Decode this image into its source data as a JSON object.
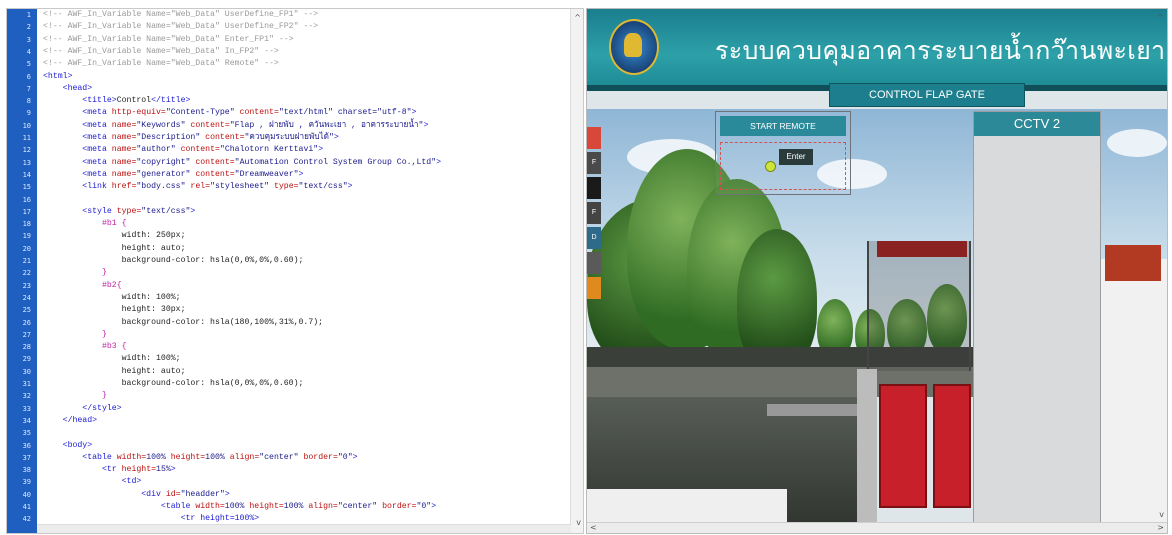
{
  "editor": {
    "line_numbers": [
      "1",
      "2",
      "3",
      "4",
      "5",
      "6",
      "7",
      "8",
      "9",
      "10",
      "11",
      "12",
      "13",
      "14",
      "15",
      "16",
      "17",
      "18",
      "19",
      "20",
      "21",
      "22",
      "23",
      "24",
      "25",
      "26",
      "27",
      "28",
      "29",
      "30",
      "31",
      "32",
      "33",
      "34",
      "35",
      "36",
      "37",
      "38",
      "39",
      "40",
      "41",
      "42"
    ],
    "lines": [
      [
        {
          "t": "<!-- AWF_In_Variable Name=\"Web_Data\" UserDefine_FP1\" -->",
          "c": "cmt"
        }
      ],
      [
        {
          "t": "<!-- AWF_In_Variable Name=\"Web_Data\" UserDefine_FP2\" -->",
          "c": "cmt"
        }
      ],
      [
        {
          "t": "<!-- AWF_In_Variable Name=\"Web_Data\" Enter_FP1\" -->",
          "c": "cmt"
        }
      ],
      [
        {
          "t": "<!-- AWF_In_Variable Name=\"Web_Data\" In_FP2\" -->",
          "c": "cmt"
        }
      ],
      [
        {
          "t": "<!-- AWF_In_Variable Name=\"Web_Data\" Remote\" -->",
          "c": "cmt"
        }
      ],
      [
        {
          "t": "<html>",
          "c": "tag"
        }
      ],
      [
        {
          "t": "    <head>",
          "c": "tag"
        }
      ],
      [
        {
          "t": "        <title>",
          "c": "tag"
        },
        {
          "t": "Control",
          "c": "prop"
        },
        {
          "t": "</title>",
          "c": "tag"
        }
      ],
      [
        {
          "t": "        <meta ",
          "c": "tag"
        },
        {
          "t": "http-equiv=",
          "c": "attr"
        },
        {
          "t": "\"Content-Type\" ",
          "c": "str"
        },
        {
          "t": "content=",
          "c": "attr"
        },
        {
          "t": "\"text/html\" charset=\"utf-8\"",
          "c": "str"
        },
        {
          "t": ">",
          "c": "tag"
        }
      ],
      [
        {
          "t": "        <meta ",
          "c": "tag"
        },
        {
          "t": "name=",
          "c": "attr"
        },
        {
          "t": "\"Keywords\" ",
          "c": "str"
        },
        {
          "t": "content=",
          "c": "attr"
        },
        {
          "t": "\"Flap , ฝายพับ , ควันพะเยา , อาคารระบายน้ำ\"",
          "c": "str"
        },
        {
          "t": ">",
          "c": "tag"
        }
      ],
      [
        {
          "t": "        <meta ",
          "c": "tag"
        },
        {
          "t": "name=",
          "c": "attr"
        },
        {
          "t": "\"Description\" ",
          "c": "str"
        },
        {
          "t": "content=",
          "c": "attr"
        },
        {
          "t": "\"ควบคุมระบบฝายพับได้\"",
          "c": "str"
        },
        {
          "t": ">",
          "c": "tag"
        }
      ],
      [
        {
          "t": "        <meta ",
          "c": "tag"
        },
        {
          "t": "name=",
          "c": "attr"
        },
        {
          "t": "\"author\" ",
          "c": "str"
        },
        {
          "t": "content=",
          "c": "attr"
        },
        {
          "t": "\"Chalotorn Kerttavi\"",
          "c": "str"
        },
        {
          "t": ">",
          "c": "tag"
        }
      ],
      [
        {
          "t": "        <meta ",
          "c": "tag"
        },
        {
          "t": "name=",
          "c": "attr"
        },
        {
          "t": "\"copyright\" ",
          "c": "str"
        },
        {
          "t": "content=",
          "c": "attr"
        },
        {
          "t": "\"Automation Control System Group Co.,Ltd\"",
          "c": "str"
        },
        {
          "t": ">",
          "c": "tag"
        }
      ],
      [
        {
          "t": "        <meta ",
          "c": "tag"
        },
        {
          "t": "name=",
          "c": "attr"
        },
        {
          "t": "\"generator\" ",
          "c": "str"
        },
        {
          "t": "content=",
          "c": "attr"
        },
        {
          "t": "\"Dreamweaver\"",
          "c": "str"
        },
        {
          "t": ">",
          "c": "tag"
        }
      ],
      [
        {
          "t": "        <link ",
          "c": "tag"
        },
        {
          "t": "href=",
          "c": "attr"
        },
        {
          "t": "\"body.css\" ",
          "c": "str"
        },
        {
          "t": "rel=",
          "c": "attr"
        },
        {
          "t": "\"stylesheet\" ",
          "c": "str"
        },
        {
          "t": "type=",
          "c": "attr"
        },
        {
          "t": "\"text/css\"",
          "c": "str"
        },
        {
          "t": ">",
          "c": "tag"
        }
      ],
      [
        {
          "t": "",
          "c": "prop"
        }
      ],
      [
        {
          "t": "        <style ",
          "c": "tag"
        },
        {
          "t": "type=",
          "c": "attr"
        },
        {
          "t": "\"text/css\"",
          "c": "str"
        },
        {
          "t": ">",
          "c": "tag"
        }
      ],
      [
        {
          "t": "            #b1 {",
          "c": "sel"
        }
      ],
      [
        {
          "t": "                width: 250px;",
          "c": "prop"
        }
      ],
      [
        {
          "t": "                height: auto;",
          "c": "prop"
        }
      ],
      [
        {
          "t": "                background-color: hsla(0,0%,0%,0.60);",
          "c": "prop"
        }
      ],
      [
        {
          "t": "            }",
          "c": "sel"
        }
      ],
      [
        {
          "t": "            #b2{",
          "c": "sel"
        }
      ],
      [
        {
          "t": "                width: 100%;",
          "c": "prop"
        }
      ],
      [
        {
          "t": "                height: 30px;",
          "c": "prop"
        }
      ],
      [
        {
          "t": "                background-color: hsla(180,100%,31%,0.7);",
          "c": "prop"
        }
      ],
      [
        {
          "t": "            }",
          "c": "sel"
        }
      ],
      [
        {
          "t": "            #b3 {",
          "c": "sel"
        }
      ],
      [
        {
          "t": "                width: 100%;",
          "c": "prop"
        }
      ],
      [
        {
          "t": "                height: auto;",
          "c": "prop"
        }
      ],
      [
        {
          "t": "                background-color: hsla(0,0%,0%,0.60);",
          "c": "prop"
        }
      ],
      [
        {
          "t": "            }",
          "c": "sel"
        }
      ],
      [
        {
          "t": "        </style>",
          "c": "tag"
        }
      ],
      [
        {
          "t": "    </head>",
          "c": "tag"
        }
      ],
      [
        {
          "t": "",
          "c": "prop"
        }
      ],
      [
        {
          "t": "    <body>",
          "c": "tag"
        }
      ],
      [
        {
          "t": "        <table ",
          "c": "tag"
        },
        {
          "t": "width=",
          "c": "attr"
        },
        {
          "t": "100% ",
          "c": "str"
        },
        {
          "t": "height=",
          "c": "attr"
        },
        {
          "t": "100% ",
          "c": "str"
        },
        {
          "t": "align=",
          "c": "attr"
        },
        {
          "t": "\"center\" ",
          "c": "str"
        },
        {
          "t": "border=",
          "c": "attr"
        },
        {
          "t": "\"0\"",
          "c": "str"
        },
        {
          "t": ">",
          "c": "tag"
        }
      ],
      [
        {
          "t": "            <tr ",
          "c": "tag"
        },
        {
          "t": "height=",
          "c": "attr"
        },
        {
          "t": "15%",
          "c": "str"
        },
        {
          "t": ">",
          "c": "tag"
        }
      ],
      [
        {
          "t": "                <td>",
          "c": "tag"
        }
      ],
      [
        {
          "t": "                    <div ",
          "c": "tag"
        },
        {
          "t": "id=",
          "c": "attr"
        },
        {
          "t": "\"headder\"",
          "c": "str"
        },
        {
          "t": ">",
          "c": "tag"
        }
      ],
      [
        {
          "t": "                        <table ",
          "c": "tag"
        },
        {
          "t": "width=",
          "c": "attr"
        },
        {
          "t": "100% ",
          "c": "str"
        },
        {
          "t": "height=",
          "c": "attr"
        },
        {
          "t": "100% ",
          "c": "str"
        },
        {
          "t": "align=",
          "c": "attr"
        },
        {
          "t": "\"center\" ",
          "c": "str"
        },
        {
          "t": "border=",
          "c": "attr"
        },
        {
          "t": "\"0\"",
          "c": "str"
        },
        {
          "t": ">",
          "c": "tag"
        }
      ],
      [
        {
          "t": "                            <tr height=100%>",
          "c": "tag"
        }
      ]
    ]
  },
  "preview": {
    "banner_title": "ระบบควบคุมอาคารระบายน้ำกว๊านพะเยา",
    "control_flap_label": "CONTROL FLAP GATE",
    "start_remote_label": "START REMOTE",
    "enter_label": "Enter",
    "cctv_label": "CCTV 2",
    "left_strip": [
      {
        "label": "",
        "color": "#d9463a"
      },
      {
        "label": "F",
        "color": "#4a4a4a"
      },
      {
        "label": "",
        "color": "#1a1a1a"
      },
      {
        "label": "F",
        "color": "#444444"
      },
      {
        "label": "D",
        "color": "#2e6a8a"
      },
      {
        "label": "",
        "color": "#5a5a5a"
      },
      {
        "label": "",
        "color": "#e08a1e"
      }
    ]
  },
  "colors": {
    "editor_gutter": "#1f5fbf",
    "banner": "#2da0a8",
    "flap_gate_red": "#c8202a",
    "accent_teal": "#1d7f8d"
  },
  "icons": {
    "logo": "department-emblem-icon",
    "status": "status-dot-icon",
    "scroll": [
      "scroll-up-icon",
      "scroll-down-icon",
      "scroll-left-icon",
      "scroll-right-icon"
    ]
  }
}
